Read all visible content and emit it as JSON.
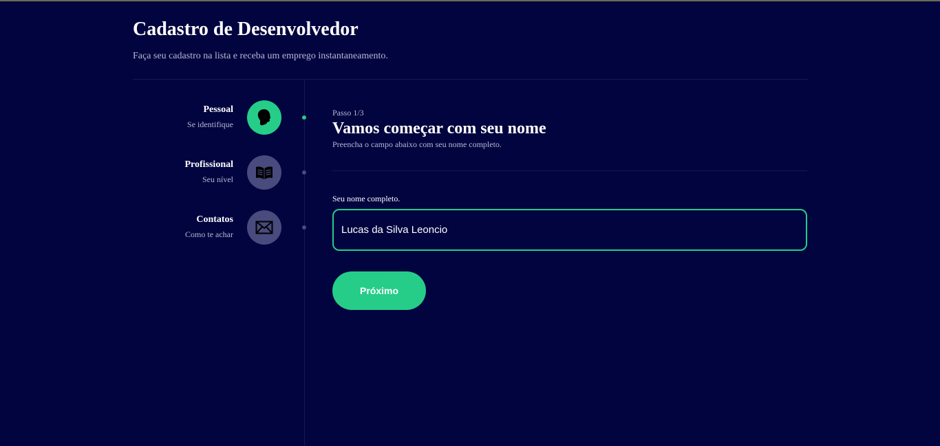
{
  "header": {
    "title": "Cadastro de Desenvolvedor",
    "subtitle": "Faça seu cadastro na lista e receba um emprego instantaneamento."
  },
  "steps": [
    {
      "title": "Pessoal",
      "subtitle": "Se identifique",
      "icon": "profile-icon",
      "active": true
    },
    {
      "title": "Profissional",
      "subtitle": "Seu nível",
      "icon": "book-icon",
      "active": false
    },
    {
      "title": "Contatos",
      "subtitle": "Como te achar",
      "icon": "mail-icon",
      "active": false
    }
  ],
  "form": {
    "step_label": "Passo 1/3",
    "title": "Vamos começar com seu nome",
    "description": "Preencha o campo abaixo com seu nome completo.",
    "field_label": "Seu nome completo.",
    "field_value": "Lucas da Silva Leoncio",
    "next_button": "Próximo"
  },
  "colors": {
    "background": "#01043f",
    "accent": "#25cd89",
    "inactive": "#494a7d"
  }
}
